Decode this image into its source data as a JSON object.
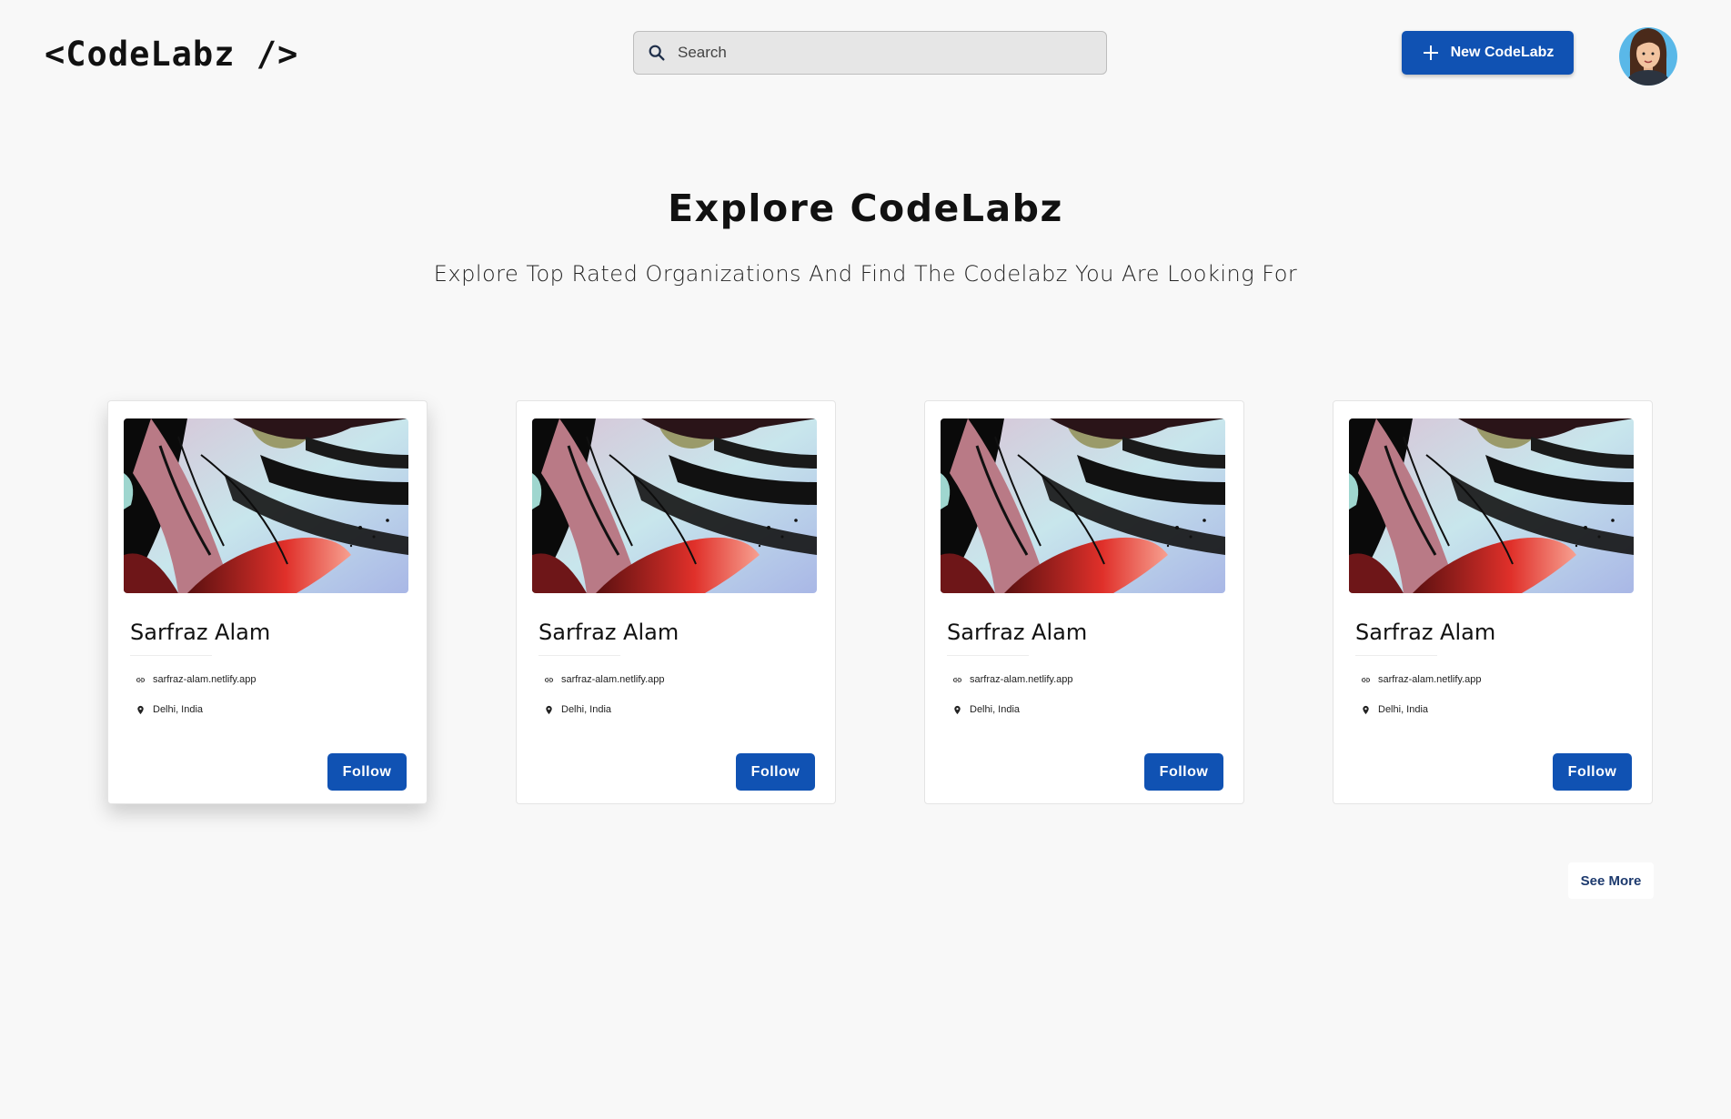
{
  "header": {
    "logo": "<CodeLabz />",
    "search_placeholder": "Search",
    "new_button_label": "New CodeLabz"
  },
  "hero": {
    "title": "Explore CodeLabz",
    "subtitle": "Explore Top Rated Organizations And Find The Codelabz You Are Looking For"
  },
  "cards": [
    {
      "name": "Sarfraz Alam",
      "website": "sarfraz-alam.netlify.app",
      "location": "Delhi, India",
      "follow_label": "Follow"
    },
    {
      "name": "Sarfraz Alam",
      "website": "sarfraz-alam.netlify.app",
      "location": "Delhi, India",
      "follow_label": "Follow"
    },
    {
      "name": "Sarfraz Alam",
      "website": "sarfraz-alam.netlify.app",
      "location": "Delhi, India",
      "follow_label": "Follow"
    },
    {
      "name": "Sarfraz Alam",
      "website": "sarfraz-alam.netlify.app",
      "location": "Delhi, India",
      "follow_label": "Follow"
    }
  ],
  "see_more_label": "See More",
  "icons": {
    "search": "search-icon",
    "add": "plus-icon",
    "link": "link-icon",
    "location": "location-pin-icon"
  },
  "colors": {
    "primary": "#1052b3",
    "background": "#f8f8f8",
    "see_more_text": "#1d3a6e"
  }
}
